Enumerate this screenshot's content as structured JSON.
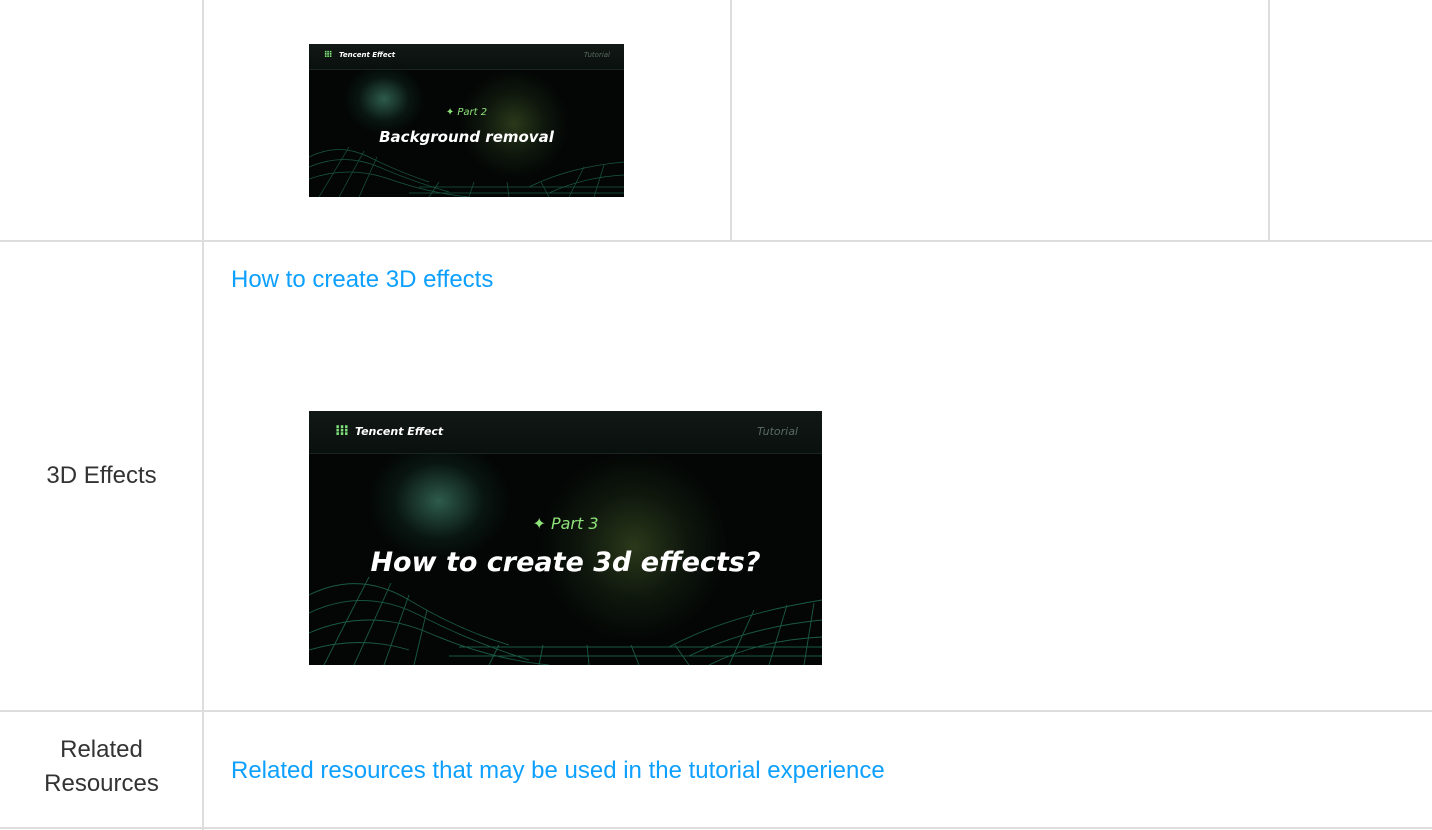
{
  "rows": [
    {
      "label": "",
      "thumbnail": {
        "brand": "Tencent Effect",
        "dots_icon": "⁝⁝⁝",
        "tag": "Tutorial",
        "part": "✦ Part 2",
        "title": "Background removal"
      }
    },
    {
      "label": "3D Effects",
      "link": "How to create 3D effects",
      "thumbnail": {
        "brand": "Tencent Effect",
        "dots_icon": "⁝⁝⁝",
        "tag": "Tutorial",
        "part": "✦ Part 3",
        "title": "How to create 3d effects?"
      }
    },
    {
      "label_lines": [
        "Related",
        "Resources"
      ],
      "link": "Related resources that may be used in the tutorial experience"
    }
  ],
  "colors": {
    "link": "#0ea0ff",
    "border": "#dddddd",
    "accent_green": "#8ee37a"
  }
}
